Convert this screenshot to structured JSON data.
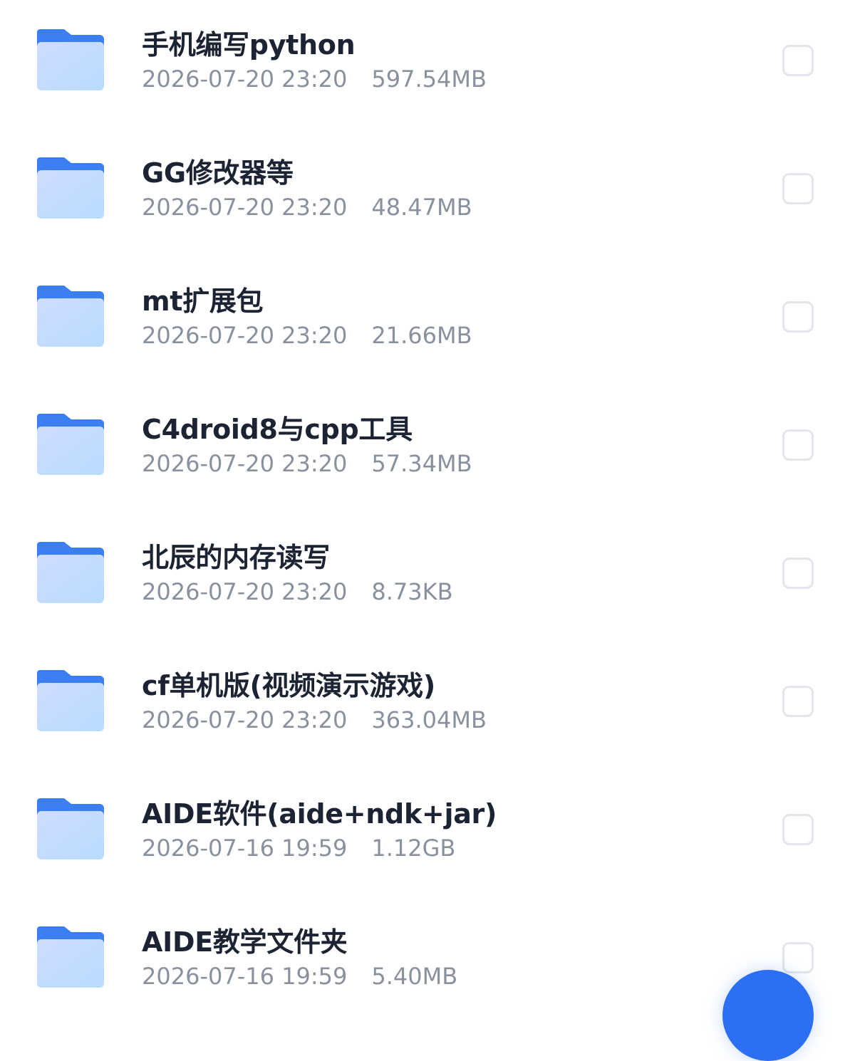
{
  "icons": {
    "folder": "folder-icon",
    "checkbox": "checkbox-unchecked"
  },
  "colors": {
    "folder_tab": "#3c7ff3",
    "folder_body_light": "#c9dcff",
    "folder_body_grad": "#b6d5ff",
    "name_text": "#1c2333",
    "meta_text": "#8a919e",
    "checkbox_border": "#e3e5ea",
    "fab": "#2d6ff2"
  },
  "files": [
    {
      "name": "手机编写python",
      "date": "2026-07-20 23:20",
      "size": "597.54MB"
    },
    {
      "name": "GG修改器等",
      "date": "2026-07-20 23:20",
      "size": "48.47MB"
    },
    {
      "name": "mt扩展包",
      "date": "2026-07-20 23:20",
      "size": "21.66MB"
    },
    {
      "name": "C4droid8与cpp工具",
      "date": "2026-07-20 23:20",
      "size": "57.34MB"
    },
    {
      "name": "北辰的内存读写",
      "date": "2026-07-20 23:20",
      "size": "8.73KB"
    },
    {
      "name": "cf单机版(视频演示游戏)",
      "date": "2026-07-20 23:20",
      "size": "363.04MB"
    },
    {
      "name": "AIDE软件(aide+ndk+jar)",
      "date": "2026-07-16 19:59",
      "size": "1.12GB"
    },
    {
      "name": "AIDE教学文件夹",
      "date": "2026-07-16 19:59",
      "size": "5.40MB"
    }
  ]
}
